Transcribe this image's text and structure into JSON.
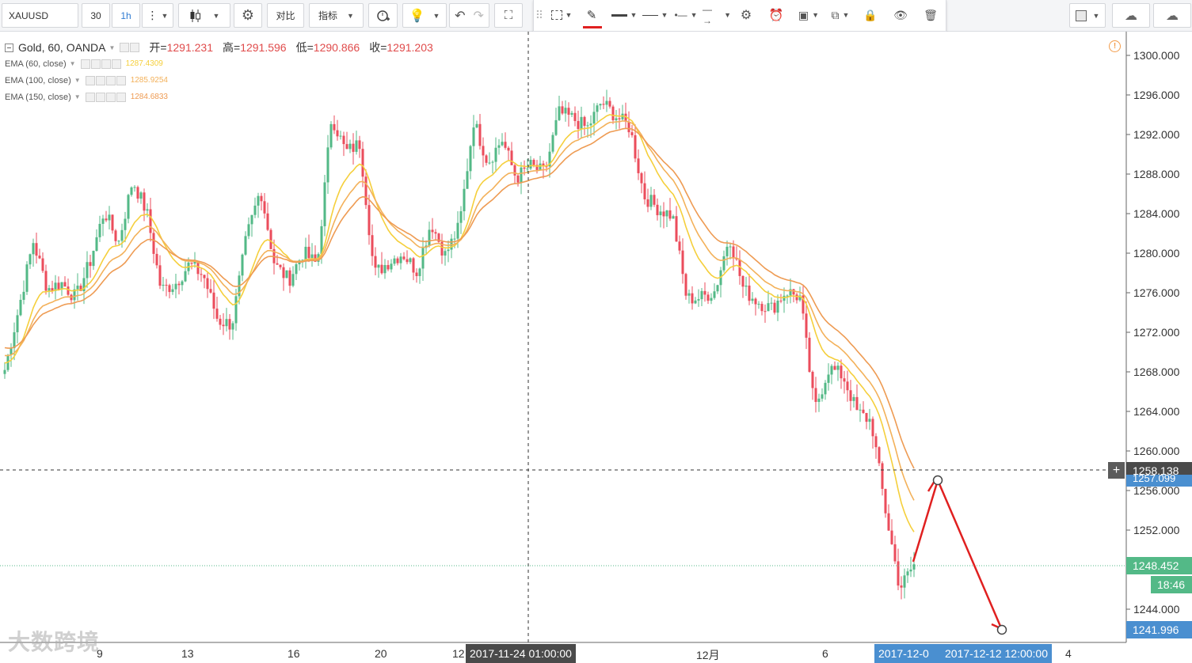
{
  "toolbar": {
    "symbol": "XAUUSD",
    "interval_input": "30",
    "interval_active": "1h",
    "compare_label": "对比",
    "indicators_label": "指标"
  },
  "legend": {
    "title": "Gold, 60, OANDA",
    "open_label": "开=",
    "open": "1291.231",
    "high_label": "高=",
    "high": "1291.596",
    "low_label": "低=",
    "low": "1290.866",
    "close_label": "收=",
    "close": "1291.203",
    "indicators": [
      {
        "name": "EMA (60, close)",
        "value": "1287.4309",
        "color": "#f5cf3c"
      },
      {
        "name": "EMA (100, close)",
        "value": "1285.9254",
        "color": "#f3b15a"
      },
      {
        "name": "EMA (150, close)",
        "value": "1284.6833",
        "color": "#ee9b53"
      }
    ]
  },
  "price_axis": {
    "ticks": [
      "1300.000",
      "1296.000",
      "1292.000",
      "1288.000",
      "1284.000",
      "1280.000",
      "1276.000",
      "1272.000",
      "1268.000",
      "1264.000",
      "1260.000",
      "1256.000",
      "1252.000",
      "1248.000",
      "1244.000"
    ],
    "crosshair_price": "1258.138",
    "drawing_price_high": "1257.099",
    "current_price": "1248.452",
    "countdown": "18:46",
    "drawing_price_low": "1241.996"
  },
  "time_axis": {
    "ticks": [
      "9",
      "13",
      "16",
      "20",
      "12",
      "12月",
      "6",
      "4"
    ],
    "crosshair_time": "2017-11-24 01:00:00",
    "drawing_time_1": "2017-12-0",
    "drawing_time_2": "2017-12-12 12:00:00"
  },
  "watermark": "大数跨境",
  "colors": {
    "up": "#53b987",
    "down": "#eb4d5c",
    "drawing": "#e02020",
    "axis_blue": "#4a8fd0",
    "axis_green": "#53b987",
    "crosshair_tag": "#4a4a4a"
  },
  "chart_data": {
    "type": "candlestick",
    "symbol": "Gold, 60, OANDA",
    "ylim": [
      1240,
      1302
    ],
    "close_path": [
      1268.2,
      1274.5,
      1281.2,
      1276.4,
      1277.0,
      1275.5,
      1279.1,
      1284.3,
      1281.0,
      1287.4,
      1284.1,
      1276.3,
      1276.9,
      1278.9,
      1277.7,
      1273.2,
      1272.8,
      1281.5,
      1286.5,
      1278.8,
      1277.3,
      1280.1,
      1278.8,
      1293.9,
      1290.2,
      1291.1,
      1277.9,
      1279.1,
      1280.0,
      1278.2,
      1283.1,
      1279.8,
      1282.7,
      1293.4,
      1289.2,
      1291.5,
      1287.6,
      1288.8,
      1288.1,
      1294.2,
      1293.6,
      1292.6,
      1295.3,
      1293.9,
      1292.7,
      1285.8,
      1284.5,
      1283.8,
      1275.4,
      1275.5,
      1276.2,
      1281.8,
      1276.3,
      1275.1,
      1274.4,
      1276.2,
      1275.5,
      1264.1,
      1268.4,
      1267.6,
      1263.9,
      1263.0,
      1253.9,
      1246.1,
      1248.5
    ],
    "ema": [
      {
        "name": "EMA (60, close)",
        "last": 1287.4309
      },
      {
        "name": "EMA (100, close)",
        "last": 1285.9254
      },
      {
        "name": "EMA (150, close)",
        "last": 1284.6833
      }
    ],
    "drawing": {
      "type": "projection-line",
      "points": [
        1248.5,
        1257.099,
        1241.996
      ]
    },
    "current_price": 1248.452
  }
}
